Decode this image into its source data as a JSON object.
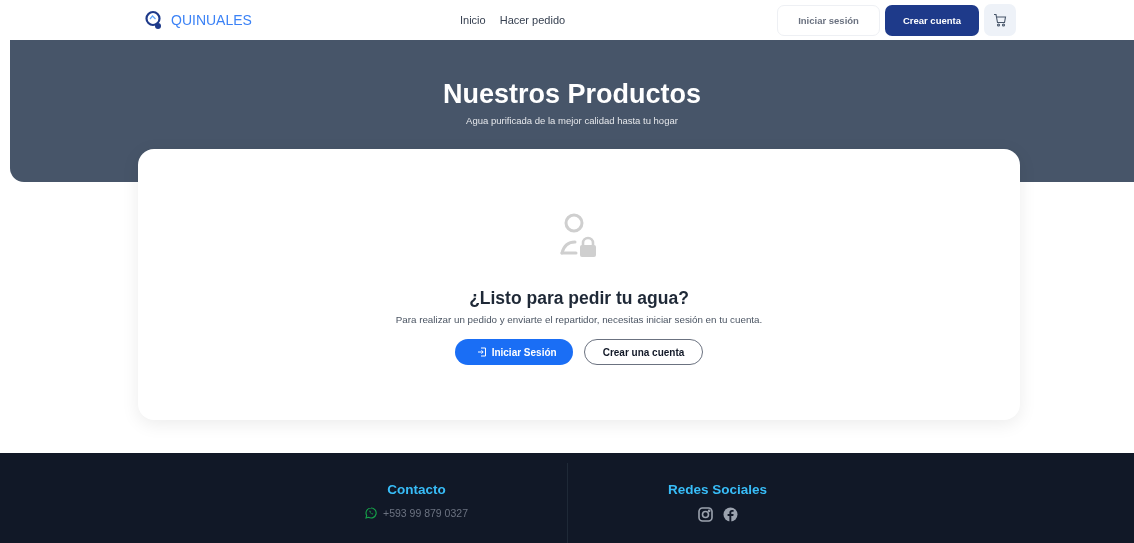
{
  "header": {
    "logo": "QUINUALES",
    "nav": [
      {
        "label": "Inicio"
      },
      {
        "label": "Hacer pedido"
      }
    ],
    "buttons": [
      {
        "label": "Iniciar sesión",
        "kind": "outline"
      },
      {
        "label": "Crear cuenta",
        "kind": "primary"
      }
    ]
  },
  "hero": {
    "title": "Nuestros Productos",
    "subtitle": "Agua purificada de la mejor calidad hasta tu hogar"
  },
  "card": {
    "heading": "¿Listo para pedir tu agua?",
    "text": "Para realizar un pedido y enviarte el repartidor, necesitas iniciar sesión en tu cuenta.",
    "buttons": [
      {
        "label": "Iniciar Sesión",
        "kind": "primary"
      },
      {
        "label": "Crear una cuenta",
        "kind": "outline"
      }
    ]
  },
  "footer": {
    "contact": {
      "title": "Contacto",
      "phone": "+593 99 879 0327"
    },
    "social": {
      "title": "Redes Sociales"
    }
  }
}
